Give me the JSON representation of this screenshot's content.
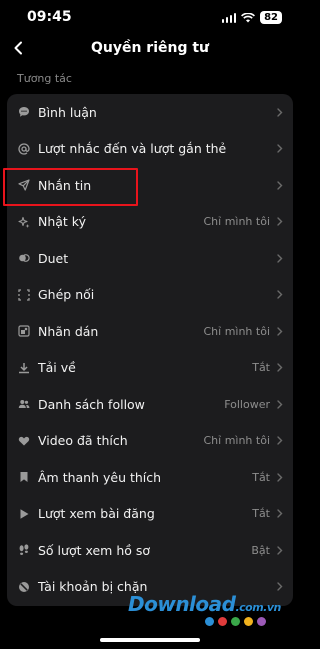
{
  "status_bar": {
    "time": "09:45",
    "battery": "82"
  },
  "header": {
    "title": "Quyền riêng tư"
  },
  "section": {
    "label": "Tương tác"
  },
  "items": [
    {
      "icon": "comment-icon",
      "label": "Bình luận",
      "value": ""
    },
    {
      "icon": "at-mention-icon",
      "label": "Lượt nhắc đến và lượt gắn thẻ",
      "value": ""
    },
    {
      "icon": "send-icon",
      "label": "Nhắn tin",
      "value": ""
    },
    {
      "icon": "sparkle-icon",
      "label": "Nhật ký",
      "value": "Chỉ mình tôi"
    },
    {
      "icon": "duet-icon",
      "label": "Duet",
      "value": ""
    },
    {
      "icon": "stitch-icon",
      "label": "Ghép nối",
      "value": ""
    },
    {
      "icon": "sticker-icon",
      "label": "Nhãn dán",
      "value": "Chỉ mình tôi"
    },
    {
      "icon": "download-icon",
      "label": "Tải về",
      "value": "Tắt"
    },
    {
      "icon": "people-icon",
      "label": "Danh sách follow",
      "value": "Follower"
    },
    {
      "icon": "heart-icon",
      "label": "Video đã thích",
      "value": "Chỉ mình tôi"
    },
    {
      "icon": "bookmark-icon",
      "label": "Âm thanh yêu thích",
      "value": "Tắt"
    },
    {
      "icon": "play-icon",
      "label": "Lượt xem bài đăng",
      "value": "Tắt"
    },
    {
      "icon": "footprint-icon",
      "label": "Số lượt xem hồ sơ",
      "value": "Bật"
    },
    {
      "icon": "block-icon",
      "label": "Tài khoản bị chặn",
      "value": ""
    }
  ],
  "watermark": {
    "brand": "Download",
    "suffix": ".com.vn"
  },
  "watermark_dot_colors": [
    "#2b8fd6",
    "#e03b3b",
    "#3aa84a",
    "#f1b21e",
    "#9b59b6"
  ]
}
